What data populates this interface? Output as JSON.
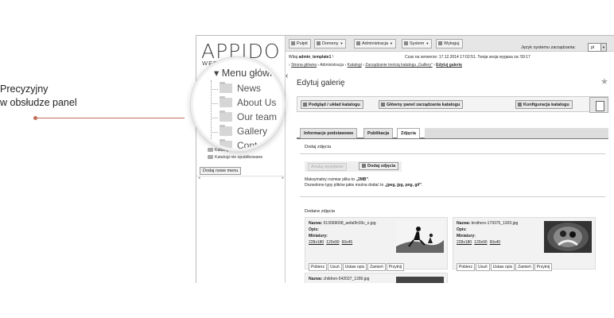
{
  "caption": {
    "line1": "Precyzyjny",
    "line2": "w obsłudze panel"
  },
  "logo": {
    "text": "APPIDO",
    "sub": "WEB"
  },
  "sidebar": {
    "items": [
      "Katalogi",
      "Katalogi nie opublikowane"
    ],
    "add_menu_button": "Dodaj nowe menu",
    "scroll_left": "◂",
    "scroll_right": "▸"
  },
  "magnifier": {
    "title": "Menu główne",
    "items": [
      "News",
      "About Us",
      "Our team",
      "Gallery",
      "Contact"
    ]
  },
  "topbar": {
    "buttons": [
      "Pulpit",
      "Domeny",
      "Administracja",
      "System",
      "Wyloguj"
    ],
    "lang_label": "Język systemu zarządzania:",
    "lang_value": "pl"
  },
  "infobar": {
    "welcome_prefix": "Witaj ",
    "user": "admin_template1",
    "welcome_suffix": " !",
    "server_time": "Czas na serwerze: 17.12.2014 17:02:51. Twoja sesja wygasa za: 59:17"
  },
  "breadcrumbs": {
    "items": [
      "Strona główna",
      "Administracja",
      "Katalogi",
      "Zarządzanie treścią katalogu „Gallery”"
    ],
    "current": "Edytuj galerię"
  },
  "page": {
    "title": "Edytuj galerię",
    "star": "★"
  },
  "actions": [
    "Podgląd / układ katalogu",
    "Główny panel zarządzania katalogu",
    "Konfiguracja katalogu"
  ],
  "tabs": [
    "Informacje podstawowe",
    "Publikacja",
    "Zdjęcia"
  ],
  "upload": {
    "section": "Dodaj zdjęcia",
    "cancel": "Anuluj wysyłanie",
    "add": "Dodaj zdjęcia",
    "max_size_prefix": "Maksymalny rozmiar pliku to ",
    "max_size_value": "„2MB”",
    "max_size_suffix": ".",
    "types_prefix": "Dozwolone typy plików jakie można dodać to ",
    "types_value": "„jpeg, jpg, png, gif”",
    "types_suffix": "."
  },
  "added": {
    "section": "Dodane zdjęcia",
    "name_label": "Nazwa:",
    "desc_label": "Opis:",
    "thumbs_label": "Miniatury:",
    "cards": [
      {
        "name": "513069008_aefa0fc93c_o.jpg",
        "thumbs": [
          "228x180",
          "120x90",
          "60x45"
        ]
      },
      {
        "name": "brothers-179375_1920.jpg",
        "thumbs": [
          "228x180",
          "120x90",
          "60x40"
        ]
      },
      {
        "name": "children-542037_1280.jpg",
        "thumbs": []
      }
    ],
    "card_actions": [
      "Pobierz",
      "Usuń",
      "Ustaw opis",
      "Zamień",
      "Przytnij"
    ]
  }
}
